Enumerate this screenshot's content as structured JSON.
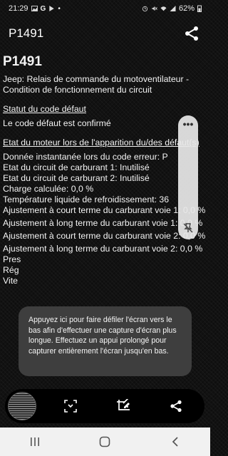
{
  "status_bar": {
    "time": "21:29",
    "google_letter": "G",
    "notification_dot": "•",
    "battery": "62%",
    "icons": [
      "gallery-icon",
      "google-icon",
      "play-icon",
      "alarm-icon",
      "mute-icon",
      "wifi-icon",
      "signal-icon",
      "battery-icon"
    ]
  },
  "app_bar": {
    "title": "P1491",
    "share_icon": "share-icon"
  },
  "content": {
    "code": "P1491",
    "description": "Jeep: Relais de commande du motoventilateur - Condition de fonctionnement du circuit",
    "status_title": "Statut du code défaut",
    "status_value": "Le code défaut est confirmé",
    "engine_title": "Etat du moteur lors de l'apparition du/des défaut(s)",
    "engine_rows": [
      "Donnée instantanée lors du code erreur: P",
      "Etat du circuit de carburant 1: Inutilisé",
      "Etat du circuit de carburant 2: Inutilisé",
      "Charge calculée: 0,0 %",
      "Température liquide de refroidissement: 36",
      "Ajustement à court terme du carburant voie 1: 0,0 %",
      "Ajustement à long terme du carburant voie 1: 0,0 %",
      "Ajustement à court terme du carburant voie 2: 0,0 %",
      "Ajustement à long terme du carburant voie 2: 0,0 %",
      "Pres",
      "Rég",
      "Vite"
    ]
  },
  "floating_panel": {
    "dots": "•••"
  },
  "tooltip": {
    "text": "Appuyez ici pour faire défiler l'écran vers le bas afin d'effectuer une capture d'écran plus longue. Effectuez un appui prolongé pour capturer entièrement l'écran jusqu'en bas."
  },
  "capture_toolbar": {
    "buttons": [
      "scroll-capture-icon",
      "crop-edit-icon",
      "share-icon"
    ]
  },
  "nav_bar": {
    "buttons": [
      "recents-icon",
      "home-icon",
      "back-icon"
    ]
  },
  "colors": {
    "background": "#121212",
    "text": "#f3f3f3",
    "tooltip_bg": "#404040",
    "nav_bg": "#f1f1f1"
  }
}
